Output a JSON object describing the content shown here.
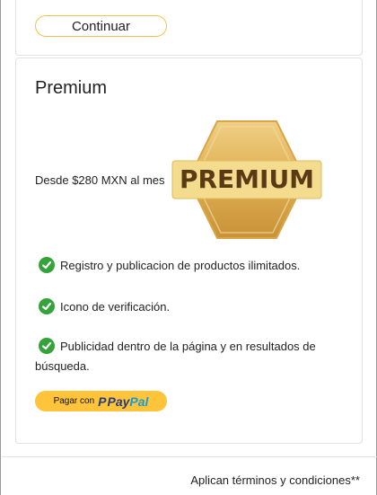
{
  "top_card": {
    "continue_label": "Continuar"
  },
  "plan": {
    "title": "Premium",
    "price": "Desde $280 MXN al mes",
    "badge_text": "PREMIUM",
    "features": [
      {
        "text": "Registro y publicacion de productos ilimitados."
      },
      {
        "text": "Icono de verificación."
      },
      {
        "text": "Publicidad dentro de la página y en resultados de búsqueda."
      }
    ],
    "paypal": {
      "prefix": "Pagar con",
      "logo_pay": "Pay",
      "logo_pal": "Pal"
    }
  },
  "footer": {
    "terms": "Aplican términos y condiciones**"
  },
  "colors": {
    "accent_yellow": "#ffc439",
    "check_green": "#35a23a",
    "badge_gold": "#e7b75a",
    "paypal_dark": "#253b80",
    "paypal_light": "#179bd7"
  }
}
